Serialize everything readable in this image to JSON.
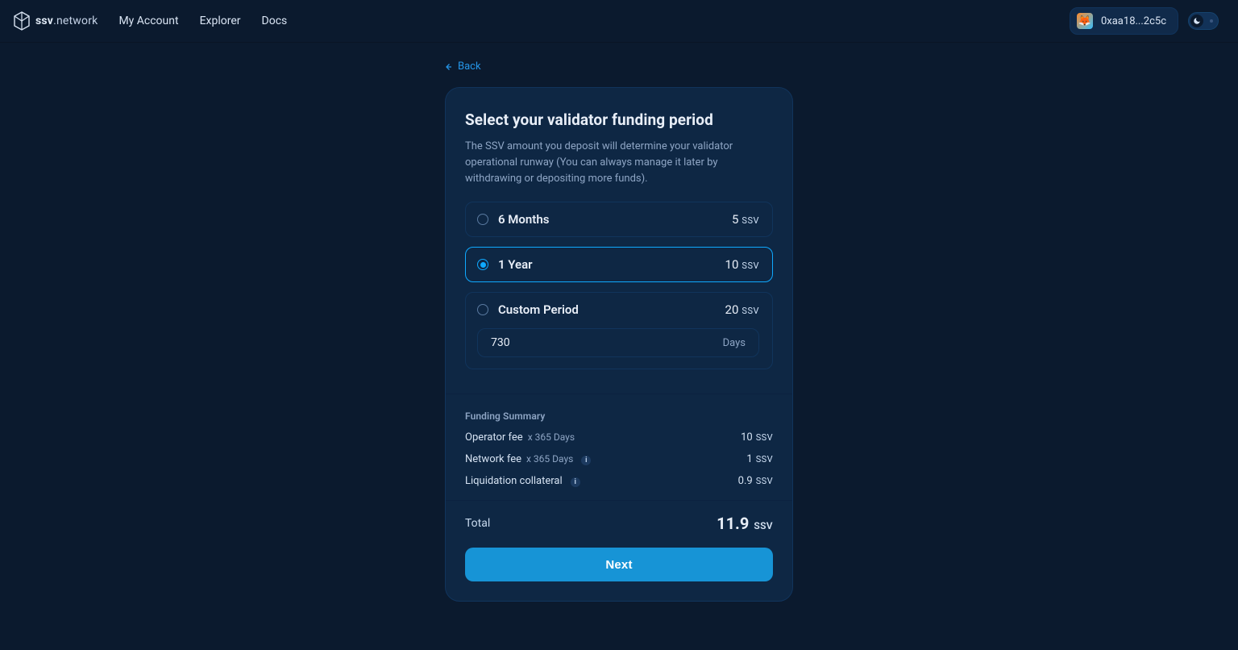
{
  "brand": {
    "name_bold": "ssv",
    "name_thin": ".network"
  },
  "nav": {
    "my_account": "My Account",
    "explorer": "Explorer",
    "docs": "Docs"
  },
  "wallet": {
    "avatar_emoji": "🦊",
    "address": "0xaa18...2c5c"
  },
  "back_label": "Back",
  "title": "Select your validator funding period",
  "description": "The SSV amount you deposit will determine your validator operational runway (You can always manage it later by withdrawing or depositing more funds).",
  "unit": "SSV",
  "options": {
    "six_months": {
      "label": "6 Months",
      "amount": "5"
    },
    "one_year": {
      "label": "1 Year",
      "amount": "10",
      "selected": true
    },
    "custom": {
      "label": "Custom Period",
      "amount": "20",
      "days_value": "730",
      "days_suffix": "Days"
    }
  },
  "summary": {
    "heading": "Funding Summary",
    "operator_fee": {
      "label": "Operator fee",
      "mult": "x 365 Days",
      "value": "10"
    },
    "network_fee": {
      "label": "Network fee",
      "mult": "x 365 Days",
      "value": "1"
    },
    "liquidation": {
      "label": "Liquidation collateral",
      "value": "0.9"
    }
  },
  "total": {
    "label": "Total",
    "value": "11.9"
  },
  "next_label": "Next"
}
